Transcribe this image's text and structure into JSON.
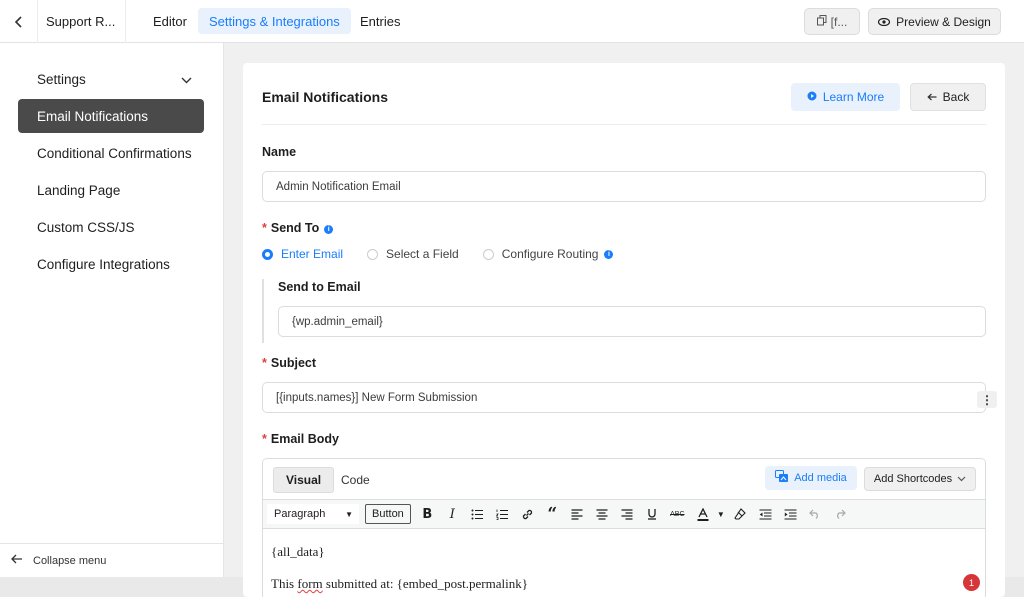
{
  "topbar": {
    "form_name": "Support R...",
    "tabs": [
      {
        "label": "Editor",
        "active": false
      },
      {
        "label": "Settings & Integrations",
        "active": true
      },
      {
        "label": "Entries",
        "active": false
      }
    ],
    "shortcode_label": "[f...",
    "preview_label": "Preview & Design",
    "accent_color": "#1a7efb"
  },
  "sidebar": {
    "items": [
      {
        "label": "Settings",
        "active": false,
        "has_chevron": true
      },
      {
        "label": "Email Notifications",
        "active": true
      },
      {
        "label": "Conditional Confirmations",
        "active": false
      },
      {
        "label": "Landing Page",
        "active": false
      },
      {
        "label": "Custom CSS/JS",
        "active": false
      },
      {
        "label": "Configure Integrations",
        "active": false
      }
    ],
    "collapse_label": "Collapse menu"
  },
  "panel": {
    "title": "Email Notifications",
    "learn_more": "Learn More",
    "back": "Back",
    "name_label": "Name",
    "name_value": "Admin Notification Email",
    "send_to_label": "Send To",
    "send_to_options": [
      {
        "label": "Enter Email",
        "selected": true
      },
      {
        "label": "Select a Field",
        "selected": false
      },
      {
        "label": "Configure Routing",
        "selected": false
      }
    ],
    "send_to_email_label": "Send to Email",
    "send_to_email_value": "{wp.admin_email}",
    "subject_label": "Subject",
    "subject_value": "[{inputs.names}] New Form Submission",
    "email_body_label": "Email Body"
  },
  "editor": {
    "tab_visual": "Visual",
    "tab_code": "Code",
    "add_media": "Add media",
    "add_shortcodes": "Add Shortcodes",
    "format_value": "Paragraph",
    "button_label": "Button",
    "line1": "{all_data}",
    "line2_prefix": "This ",
    "line2_squiggle": "form",
    "line2_suffix": " submitted at: {embed_post.permalink}",
    "notice_count": "1"
  }
}
